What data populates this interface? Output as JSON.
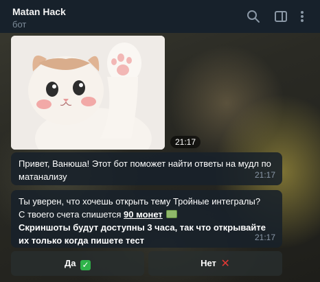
{
  "header": {
    "title": "Matan Hack",
    "subtitle": "бот",
    "icons": [
      "search-icon",
      "sidebar-toggle-icon",
      "more-vertical-icon"
    ]
  },
  "photo": {
    "subject": "kitten-waving",
    "time": "21:17"
  },
  "messages": [
    {
      "text": "Привет, Ванюша! Этот бот поможет найти ответы на мудл по матанализу",
      "time": "21:17"
    },
    {
      "line1": "Ты уверен, что хочешь открыть тему Тройные интегралы?",
      "line2_prefix": "С твоего счета спишется ",
      "coins": "90 монет",
      "coins_emoji": "money-icon",
      "line3": "Скриншоты будут доступны 3 часа, так что открывайте их только когда пишете тест",
      "time": "21:17"
    }
  ],
  "keyboard": {
    "yes_label": "Да",
    "yes_icon": "check-mark-icon",
    "no_label": "Нет",
    "no_icon": "cross-mark-icon"
  },
  "colors": {
    "header_bg": "#17212b",
    "bubble_bg": "#18212a",
    "time_color": "#8a98a8",
    "check_green": "#2fb34a",
    "cross_red": "#e53935"
  }
}
